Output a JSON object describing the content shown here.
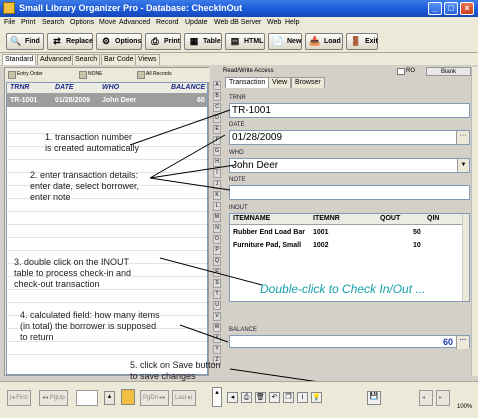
{
  "window": {
    "title": "Small Library Organizer Pro - Database: CheckInOut"
  },
  "menu": [
    "File",
    "Print",
    "Search",
    "Options",
    "Move",
    "Advanced",
    "Record",
    "Update",
    "Web dB Server",
    "Web",
    "Help"
  ],
  "toolbar": [
    "Find",
    "Replace",
    "Options",
    "Print",
    "Table",
    "HTML",
    "New",
    "Load",
    "Exit"
  ],
  "view_tabs": [
    "Standard",
    "Advanced",
    "Search",
    "Bar Code",
    "Views"
  ],
  "left_subtoolbar": [
    "Entry Order",
    "NONE",
    "All Records"
  ],
  "grid": {
    "columns": [
      "TRNR",
      "DATE",
      "WHO",
      "BALANCE"
    ],
    "rows": [
      {
        "trnr": "TR-1001",
        "date": "01/28/2009",
        "who": "John Deer",
        "balance": "60"
      }
    ]
  },
  "record_header": {
    "mode": "Read/Write Access",
    "ro_label": "RO",
    "blank_label": "Blank"
  },
  "form_tabs": [
    "Transaction",
    "View",
    "Browser"
  ],
  "fields": {
    "trnr": {
      "label": "TRNR",
      "value": "TR-1001"
    },
    "date": {
      "label": "DATE",
      "value": "01/28/2009"
    },
    "who": {
      "label": "WHO",
      "value": "John Deer"
    },
    "note": {
      "label": "NOTE",
      "value": ""
    },
    "inout": {
      "label": "INOUT",
      "columns": [
        "ITEMNAME",
        "ITEMNR",
        "QOUT",
        "QIN"
      ],
      "rows": [
        {
          "itemname": "Rubber End Load Bar",
          "itemnr": "1001",
          "qout": "50",
          "qin": ""
        },
        {
          "itemname": "Furniture Pad, Small",
          "itemnr": "1002",
          "qout": "10",
          "qin": ""
        }
      ],
      "hint": "Double-click to Check In/Out ..."
    },
    "balance": {
      "label": "BALANCE",
      "value": "60"
    }
  },
  "letters": [
    "A",
    "B",
    "C",
    "D",
    "E",
    "F",
    "G",
    "H",
    "I",
    "J",
    "K",
    "L",
    "M",
    "N",
    "O",
    "P",
    "Q",
    "R",
    "S",
    "T",
    "U",
    "V",
    "W",
    "X",
    "Y",
    "Z"
  ],
  "annotations": [
    "1. transaction number\nis created automatically",
    "2. enter transaction details:\nenter date, select borrower,\nenter note",
    "3. double click on the INOUT\ntable to process check-in and\ncheck-out transaction",
    "4. calculated field: how many items\n(in total) the borrower is supposed\nto return",
    "5. click on Save button\nto save changes"
  ],
  "bottom_nav": [
    "First",
    "PgUp",
    "PgDn",
    "Last"
  ],
  "zoom_label": "100%"
}
